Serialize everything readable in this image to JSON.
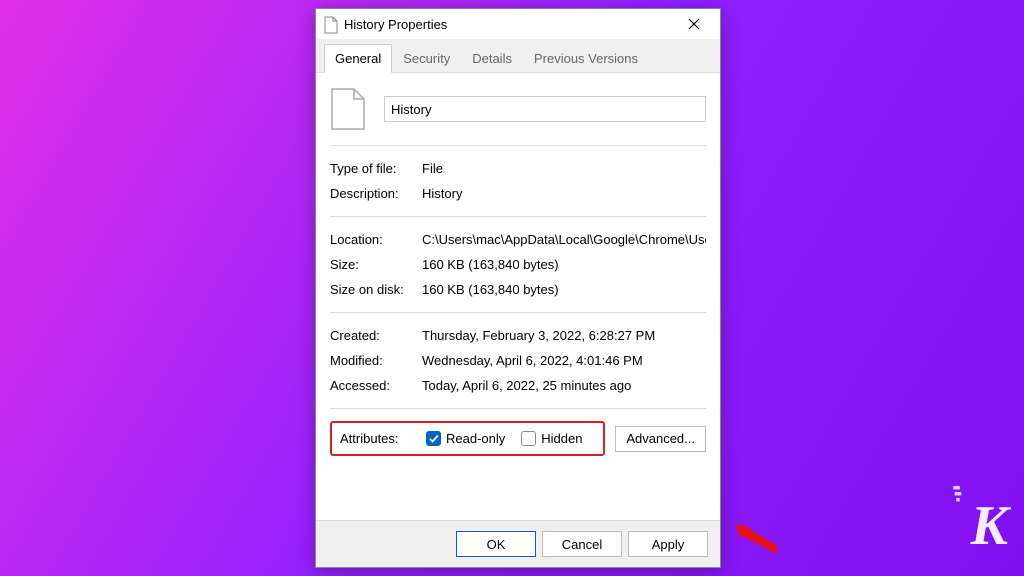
{
  "dialog": {
    "title": "History Properties",
    "tabs": [
      "General",
      "Security",
      "Details",
      "Previous Versions"
    ],
    "active_tab": "General",
    "filename": "History",
    "sections": {
      "basic": {
        "type_label": "Type of file:",
        "type_value": "File",
        "desc_label": "Description:",
        "desc_value": "History"
      },
      "location": {
        "location_label": "Location:",
        "location_value": "C:\\Users\\mac\\AppData\\Local\\Google\\Chrome\\User I",
        "size_label": "Size:",
        "size_value": "160 KB (163,840 bytes)",
        "disk_label": "Size on disk:",
        "disk_value": "160 KB (163,840 bytes)"
      },
      "dates": {
        "created_label": "Created:",
        "created_value": "Thursday, February 3, 2022, 6:28:27 PM",
        "modified_label": "Modified:",
        "modified_value": "Wednesday, April 6, 2022, 4:01:46 PM",
        "accessed_label": "Accessed:",
        "accessed_value": "Today, April 6, 2022, 25 minutes ago"
      },
      "attributes": {
        "label": "Attributes:",
        "readonly_label": "Read-only",
        "readonly_checked": true,
        "hidden_label": "Hidden",
        "hidden_checked": false,
        "advanced_label": "Advanced..."
      }
    },
    "buttons": {
      "ok": "OK",
      "cancel": "Cancel",
      "apply": "Apply"
    }
  },
  "watermark": "K"
}
